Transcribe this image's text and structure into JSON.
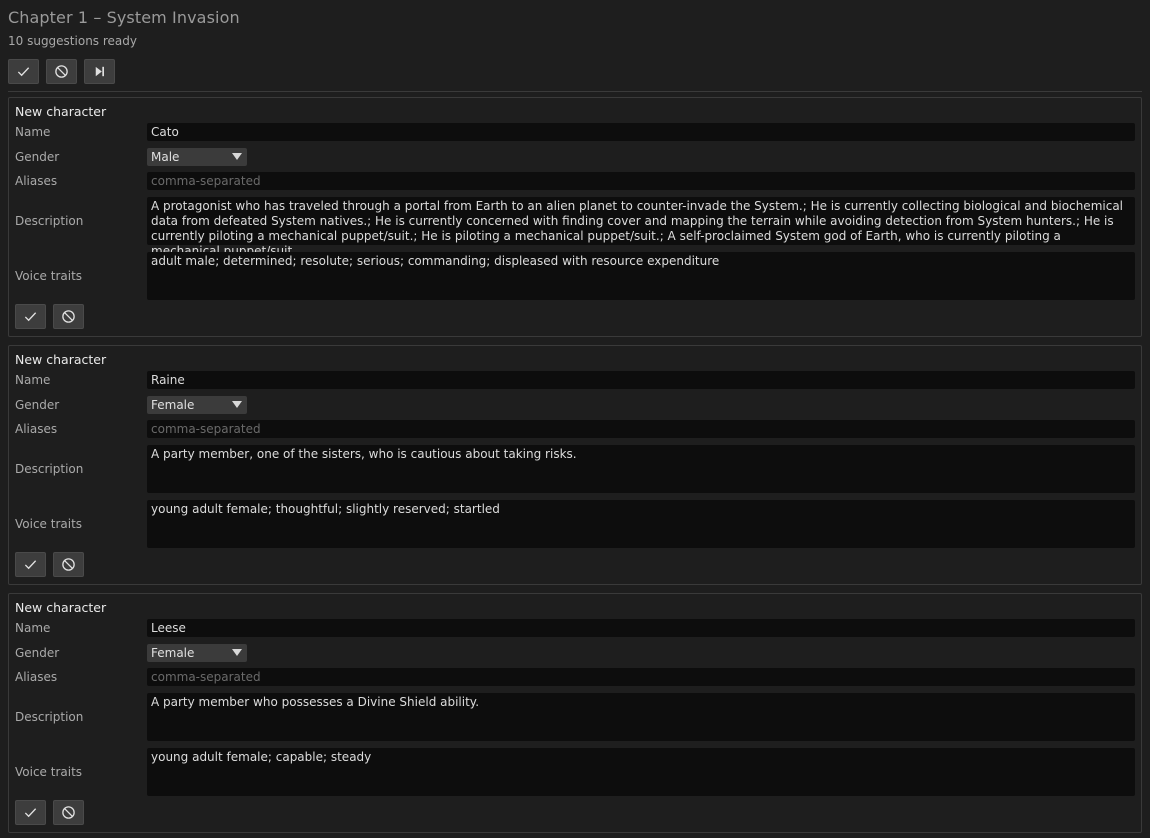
{
  "header": {
    "title": "Chapter 1 – System Invasion",
    "status": "10 suggestions ready"
  },
  "toolbar": {
    "accept_all_icon": "check-icon",
    "reject_all_icon": "block-icon",
    "skip_icon": "skip-next-icon"
  },
  "labels": {
    "card_header": "New character",
    "name": "Name",
    "gender": "Gender",
    "aliases": "Aliases",
    "description": "Description",
    "voice_traits": "Voice traits"
  },
  "aliases_placeholder": "comma-separated",
  "cards": [
    {
      "name": "Cato",
      "gender": "Male",
      "aliases": "",
      "description": "A protagonist who has traveled through a portal from Earth to an alien planet to counter-invade the System.; He is currently collecting biological and biochemical data from defeated System natives.; He is currently concerned with finding cover and mapping the terrain while avoiding detection from System hunters.; He is currently piloting a mechanical puppet/suit.; He is piloting a mechanical puppet/suit.; A self-proclaimed System god of Earth, who is currently piloting a mechanical puppet/suit.",
      "voice_traits": "adult male; determined; resolute; serious; commanding; displeased with resource expenditure"
    },
    {
      "name": "Raine",
      "gender": "Female",
      "aliases": "",
      "description": "A party member, one of the sisters, who is cautious about taking risks.",
      "voice_traits": "young adult female; thoughtful; slightly reserved; startled"
    },
    {
      "name": "Leese",
      "gender": "Female",
      "aliases": "",
      "description": "A party member who possesses a Divine Shield ability.",
      "voice_traits": "young adult female; capable; steady"
    }
  ],
  "colors": {
    "background": "#1e1e1e",
    "field_bg": "#0d0d0d",
    "button_bg": "#3d3d3d",
    "border": "#3a3a3a"
  }
}
